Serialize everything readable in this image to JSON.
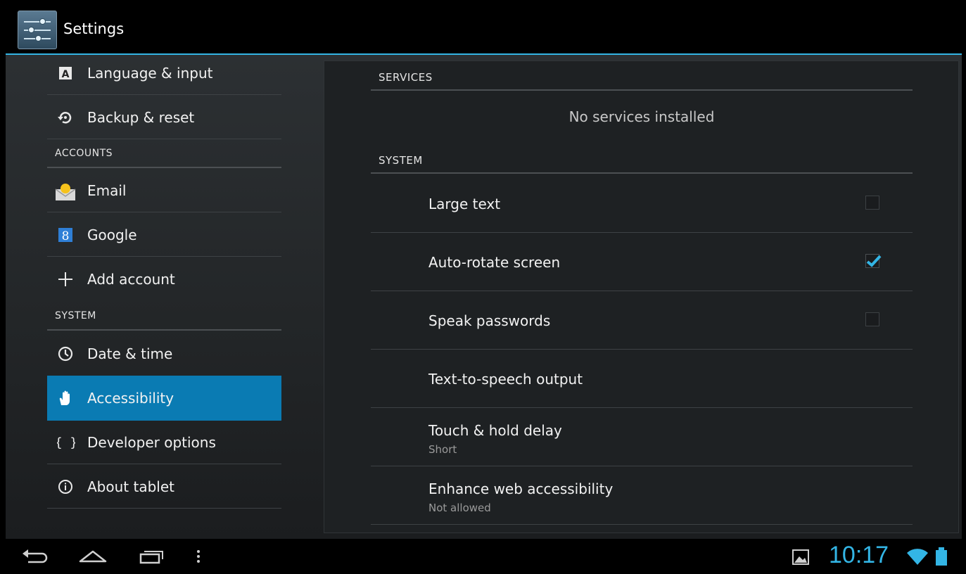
{
  "app": {
    "title": "Settings"
  },
  "sidebar": {
    "items": [
      {
        "label": "Language & input",
        "icon": "language-icon"
      },
      {
        "label": "Backup & reset",
        "icon": "backup-icon"
      },
      {
        "header": "ACCOUNTS"
      },
      {
        "label": "Email",
        "icon": "email-icon"
      },
      {
        "label": "Google",
        "icon": "google-icon"
      },
      {
        "label": "Add account",
        "icon": "add-icon"
      },
      {
        "header": "SYSTEM"
      },
      {
        "label": "Date & time",
        "icon": "clock-icon"
      },
      {
        "label": "Accessibility",
        "icon": "accessibility-hand-icon",
        "selected": true
      },
      {
        "label": "Developer options",
        "icon": "developer-braces-icon"
      },
      {
        "label": "About tablet",
        "icon": "info-icon"
      }
    ]
  },
  "content": {
    "services_header": "SERVICES",
    "no_services": "No services installed",
    "system_header": "SYSTEM",
    "prefs": [
      {
        "title": "Large text",
        "checked": false
      },
      {
        "title": "Auto-rotate screen",
        "checked": true
      },
      {
        "title": "Speak passwords",
        "checked": false
      },
      {
        "title": "Text-to-speech output"
      },
      {
        "title": "Touch & hold delay",
        "summary": "Short"
      },
      {
        "title": "Enhance web accessibility",
        "summary": "Not allowed"
      }
    ]
  },
  "status": {
    "time": "10:17",
    "accent": "#33b5e5",
    "selected_bg": "#0a7bb3"
  }
}
